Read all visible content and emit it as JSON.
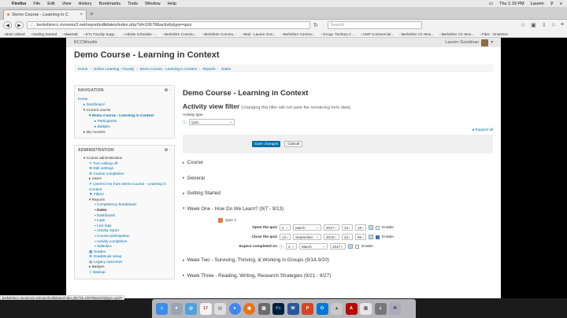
{
  "menubar": {
    "app": "Firefox",
    "items": [
      "File",
      "Edit",
      "View",
      "History",
      "Bookmarks",
      "Tools",
      "Window",
      "Help"
    ],
    "clock": "Thu 1:19 PM",
    "user": "Lauren"
  },
  "browser": {
    "tab_title": "Demo Course - Learning in C",
    "url": "berkshirecc.mrooms3.net/report/editdates/index.php?id=10678&activitytype=quiz",
    "search_placeholder": "Search",
    "bookmarks": [
      "Most Visited",
      "Getting Started",
      "MassHE",
      "ETL Faculty Supp...",
      "Advise Schedule -...",
      "Berkshire Commu...",
      "Berkshire Commu...",
      "Mail - Lauren Goo...",
      "Berkshire Commu...",
      "Group: Territory 2 ...",
      "CMP Commercial...",
      "Berkshire CC Moo...",
      "Berkshire CC Moo...",
      "Files - OneDrive"
    ]
  },
  "site": {
    "logo": "BCCMoodle",
    "user_name": "Lauren Goodman",
    "course_title": "Demo Course - Learning in Context",
    "breadcrumb": [
      "Home",
      "Online Learning - Faculty",
      "Demo Course - Learning in Context",
      "Reports",
      "Dates"
    ]
  },
  "navigation": {
    "title": "NAVIGATION",
    "home": "Home",
    "dashboard": "Dashboard",
    "current_course": "Current course",
    "course": "Demo Course - Learning in Context",
    "participants": "Participants",
    "badges": "Badges",
    "my_courses": "My courses"
  },
  "administration": {
    "title": "ADMINISTRATION",
    "course_admin": "Course administration",
    "items": [
      "Turn editing off",
      "Edit settings",
      "Course completion"
    ],
    "users": "Users",
    "unenrol": "Unenrol me from Demo Course - Learning in Context",
    "filters": "Filters",
    "reports": "Reports",
    "report_items": [
      "Competency breakdown",
      "Dates",
      "Dashboard",
      "Logs",
      "Live logs",
      "Activity report",
      "Course participation",
      "Activity completion",
      "Statistics"
    ],
    "after": [
      "Grades",
      "Gradebook setup",
      "Legacy outcomes"
    ],
    "badges": "Badges",
    "backup": "Backup"
  },
  "main": {
    "title": "Demo Course - Learning in Context",
    "filter_heading": "Activity view filter",
    "filter_note": "(changing this filter will not save the remaining form data)",
    "activity_type_label": "Activity type",
    "activity_type_value": "Quiz",
    "expand_all": "Expand all",
    "save_button": "Save changes",
    "cancel_button": "Cancel",
    "sections_top": [
      "Course",
      "General",
      "Getting Started"
    ],
    "week_one": "Week One - How Do We Learn? (9/7 - 9/13)",
    "quiz_name": "Quiz 1",
    "open_label": "Open the quiz",
    "open": {
      "day": "2",
      "month": "March",
      "year": "2017",
      "hour": "13",
      "minute": "18"
    },
    "close_label": "Close the quiz",
    "close": {
      "day": "13",
      "month": "September",
      "year": "2016",
      "hour": "23",
      "minute": "55"
    },
    "expect_label": "Expect completed on",
    "expect": {
      "day": "2",
      "month": "March",
      "year": "2017"
    },
    "enable": "Enable",
    "week_two": "Week Two - Surviving, Thriving, & Working in Groups (9/14-9/20)",
    "week_three": "Week Three - Reading, Writing, Research Strategies (9/21 - 9/27)"
  },
  "status_url": "berkshirecc.mrooms3.net/report/editdates/index.php?id=10678&activitytype=quiz#",
  "dock": [
    "finder",
    "launchpad",
    "safari",
    "calendar",
    "chrome",
    "firefox",
    "outlook",
    "photoshop",
    "word",
    "acrobat",
    "trash"
  ]
}
